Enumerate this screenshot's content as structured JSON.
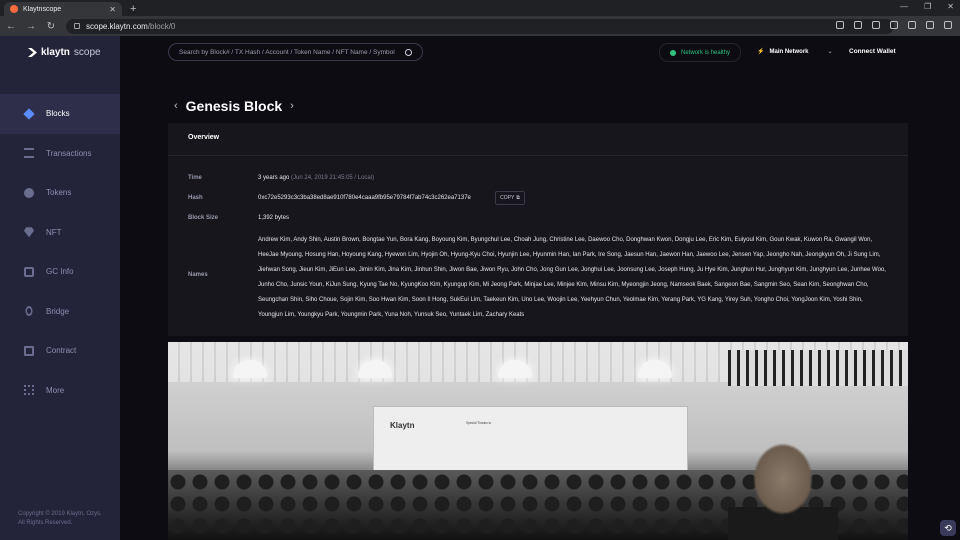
{
  "browser": {
    "tab_title": "Klaytnscope",
    "url_host": "scope.klaytn.com",
    "url_path": "/block/0"
  },
  "sidebar": {
    "brand": "klaytn",
    "brand_suffix": "scope",
    "items": [
      {
        "label": "Blocks",
        "icon": "cube-icon",
        "active": true
      },
      {
        "label": "Transactions",
        "icon": "transactions-icon",
        "active": false
      },
      {
        "label": "Tokens",
        "icon": "tokens-icon",
        "active": false
      },
      {
        "label": "NFT",
        "icon": "nft-icon",
        "active": false
      },
      {
        "label": "GC Info",
        "icon": "gc-info-icon",
        "active": false
      },
      {
        "label": "Bridge",
        "icon": "bridge-icon",
        "active": false
      },
      {
        "label": "Contract",
        "icon": "contract-icon",
        "active": false
      },
      {
        "label": "More",
        "icon": "more-icon",
        "active": false
      }
    ],
    "copyright_line1": "Copyright © 2019 Klaytn, Ozys.",
    "copyright_line2": "All Rights Reserved."
  },
  "header": {
    "search_placeholder": "Search by Block# / TX Hash / Account / Token Name / NFT Name / Symbol",
    "network_status": "Network is healthy",
    "network_name": "Main Network",
    "connect_wallet": "Connect Wallet"
  },
  "page": {
    "title": "Genesis Block",
    "overview_label": "Overview",
    "time_label": "Time",
    "time_value": "3 years ago",
    "time_detail": "(Jun 24, 2019 21:45:05 / Local)",
    "hash_label": "Hash",
    "hash_value": "0xc72e5293c3c3ba38ed8ae910f780e4caaa9fb95e79784f7ab74c3c262ea7137e",
    "copy_label": "COPY",
    "size_label": "Block Size",
    "size_value": "1,392 bytes",
    "names_label": "Names",
    "names_value": "Andrew Kim, Andy Shin, Austin Brown, Bongtae Yun, Bora Kang, Boyoung Kim, Byungchul Lee, Choah Jung, Christine Lee, Daewoo Cho, Donghwan Kwon, Dongju Lee, Eric Kim, Euiyoul Kim, Goun Kwak, Kuwon Ra, Gwangil Won, HeeJae Myoung, Hosung Han, Hoyoung Kang, Hyewon Lim, Hyojin Oh, Hyung-Kyu Choi, Hyunjin Lee, Hyunmin Han, Ian Park, Ire Song, Jaesun Han, Jaewon Han, Jaewoo Lee, Jensen Yap, Jeongho Nah, Jeongkyun Oh, Ji Sung Lim, Jiehwan Song, Jieun Kim, JiEun Lee, Jimin Kim, Jina Kim, Jinhun Shin, Jiwon Bae, Jiwon Ryu, John Cho, Jong Gun Lee, Jonghui Lee, Joonsung Lee, Joseph Hung, Ju Hye Kim, Junghun Hur, Junghyun Kim, Junghyun Lee, Junhee Woo, Junho Cho, Junsic Youn, KiJun Sung, Kyung Tae No, KyungKoo Kim, Kyungup Kim, Mi Jeong Park, Minjae Lee, Minjee Kim, Minsu Kim, Myeongjin Jeong, Namseok Baek, Sangeon Bae, Sangmin Seo, Sean Kim, Seonghwan Cho, Seungchan Shin, Siho Choue, Sojin Kim, Soo Hwan Kim, Soon Il Hong, SukEui Lim, Taekeun Kim, Uno Lee, Woojin Lee, Yeehyun Chun, Yeolmae Kim, Yerang Park, YG Kang, Yirey Suh, Yongho Choi, YongJoon Kim, Yoshi Shin, Youngjun Lim, Youngkyu Park, Youngmin Park, Yuna Noh, Yunsuk Seo, Yuntaek Lim, Zachary Keats"
  },
  "photo": {
    "brand": "Klaytn",
    "thanks_title": "Special Thanks to"
  },
  "colors": {
    "sidebar_bg": "#23233a",
    "active_item_bg": "#2e2e4a",
    "accent_blue": "#5a8cff",
    "healthy_green": "#2ec27e"
  }
}
